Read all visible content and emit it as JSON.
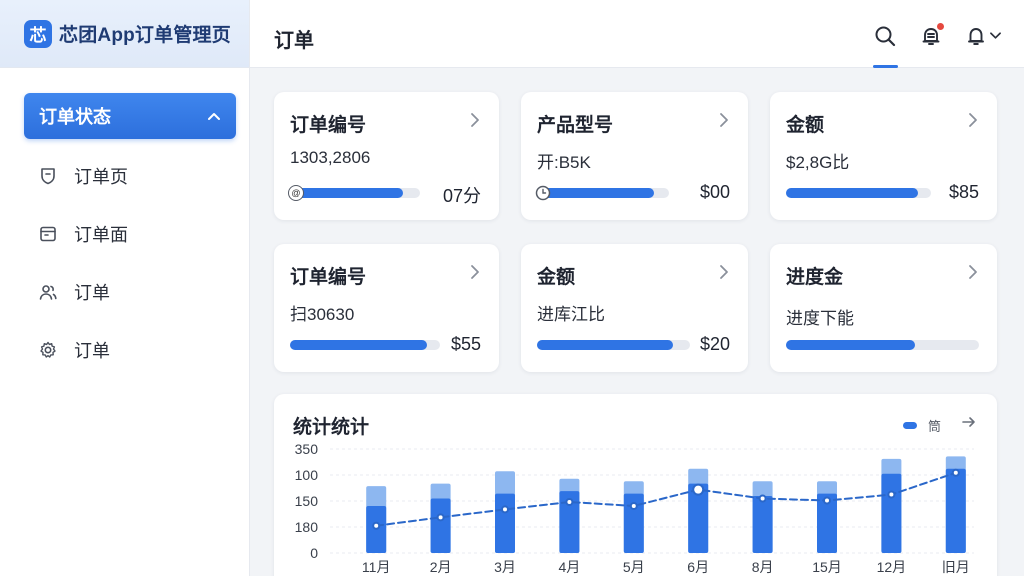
{
  "app": {
    "logo_char": "芯",
    "title": "芯团App订单管理页"
  },
  "sidebar": {
    "group_label": "订单状态",
    "items": [
      {
        "label": "订单页",
        "icon": "shield-icon"
      },
      {
        "label": "订单面",
        "icon": "calendar-icon"
      },
      {
        "label": "订单",
        "icon": "users-icon"
      },
      {
        "label": "订单",
        "icon": "gear-icon"
      }
    ]
  },
  "header": {
    "title": "订单",
    "icons": [
      "search-icon",
      "notification-bell-icon",
      "bell-icon",
      "chevron-down-icon"
    ],
    "accent": "#2f74e4",
    "badge_color": "#e5483f"
  },
  "cards": [
    {
      "title": "订单编号",
      "value": "1303,2806",
      "amount": "07分",
      "progress": 0.87,
      "knob": "@"
    },
    {
      "title": "产品型号",
      "value": "开:B5K",
      "amount": "$00",
      "progress": 0.89,
      "knob": "clock"
    },
    {
      "title": "金额",
      "value": "$2,8G比",
      "amount": "$85",
      "progress": 0.91,
      "knob": ""
    },
    {
      "title": "订单编号",
      "value": "扫30630",
      "amount": "$55",
      "progress": 0.91,
      "knob": ""
    },
    {
      "title": "金额",
      "value": "进库江比",
      "amount": "$20",
      "progress": 0.89,
      "knob": ""
    },
    {
      "title": "进度金",
      "value": "进度下能",
      "amount": "",
      "progress": 0.67,
      "knob": ""
    }
  ],
  "chart_data": {
    "type": "bar",
    "title": "统计统计",
    "legend": "筒",
    "y_tick_labels": [
      "350",
      "100",
      "150",
      "180",
      "0"
    ],
    "categories": [
      "11月",
      "2月",
      "3月",
      "4月",
      "5月",
      "6月",
      "8月",
      "15月",
      "12月",
      "旧月"
    ],
    "series": [
      {
        "values": [
          135,
          140,
          165,
          150,
          145,
          170,
          145,
          145,
          190,
          195
        ]
      },
      {
        "values": [
          95,
          110,
          120,
          125,
          120,
          140,
          115,
          120,
          160,
          170
        ]
      }
    ],
    "line": [
      55,
      72,
      88,
      103,
      95,
      128,
      110,
      106,
      118,
      162
    ],
    "ylim": [
      0,
      210
    ],
    "colors": {
      "bar_light": "#8db7f0",
      "bar_dark": "#2f74e4",
      "line": "#2a67c9"
    }
  }
}
